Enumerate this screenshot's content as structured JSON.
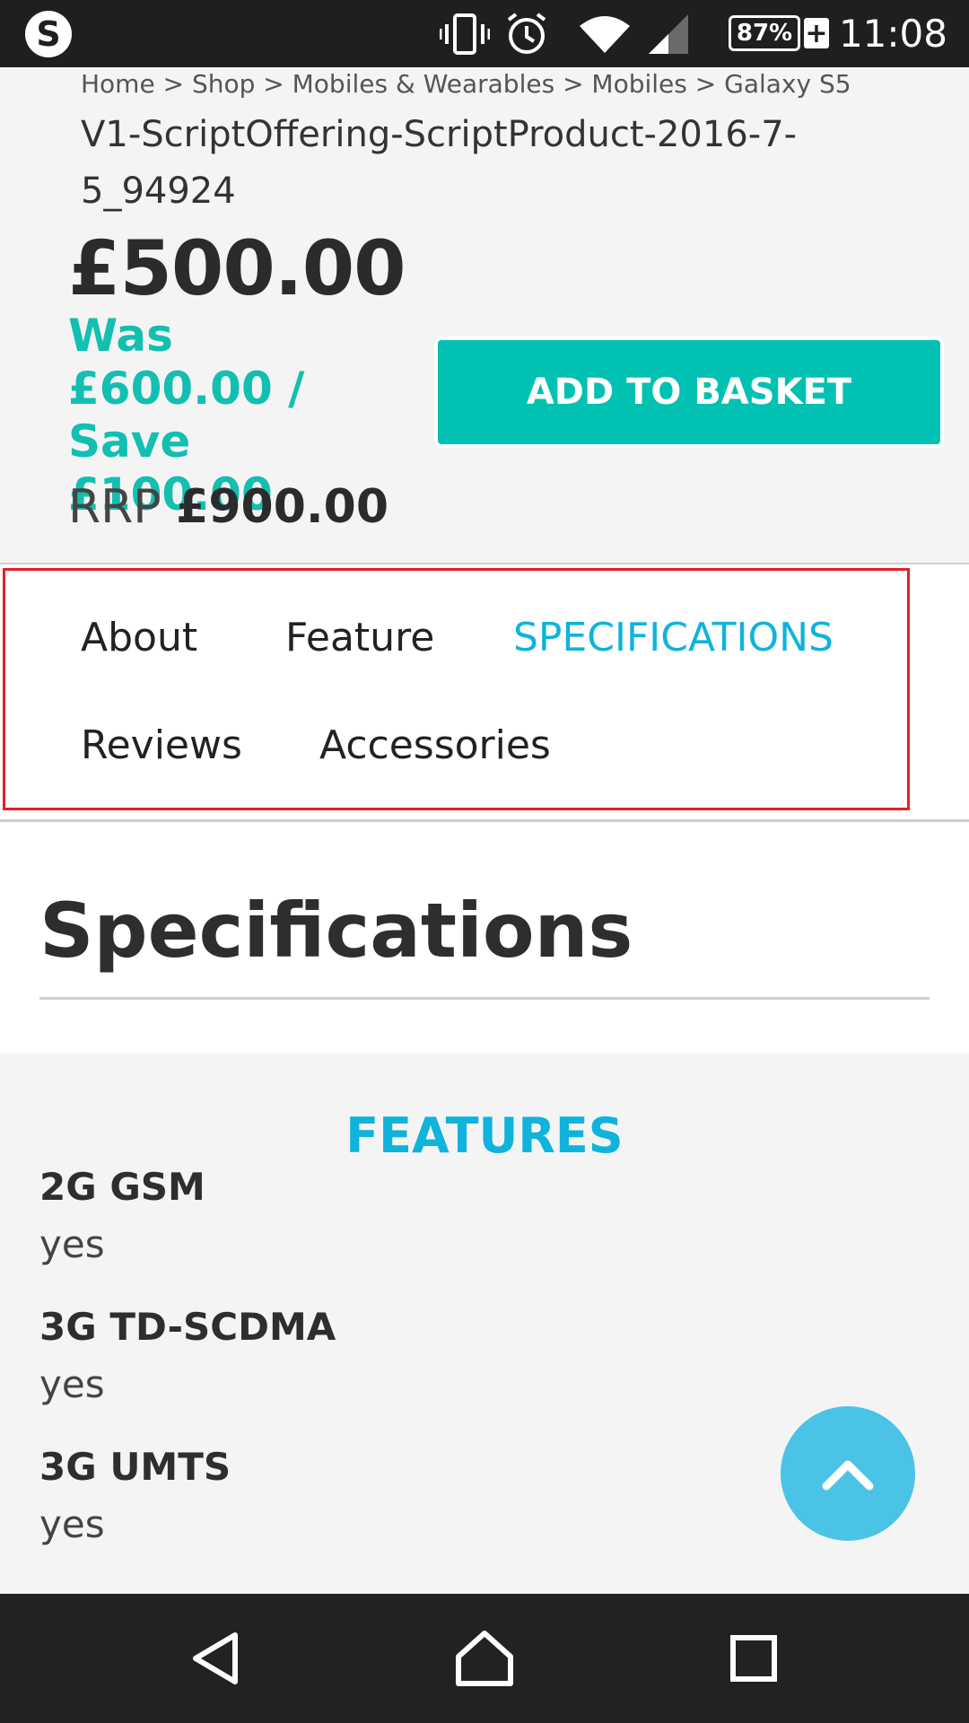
{
  "status_bar": {
    "time": "11:08",
    "battery": "87%",
    "battery_charging": "+",
    "icons": [
      "skype-icon",
      "vibrate-icon",
      "alarm-icon",
      "wifi-icon",
      "signal-icon",
      "battery-icon"
    ]
  },
  "breadcrumb": "Home > Shop >  Mobiles & Wearables >  Mobiles >  Galaxy S5",
  "product": {
    "title": "V1-ScriptOffering-ScriptProduct-2016-7-5_94924",
    "price": "£500.00",
    "was_text": "Was £600.00 / Save £100.00",
    "rrp_label": "RRP",
    "rrp_value": "£900.00",
    "add_button": "ADD TO BASKET"
  },
  "tabs": [
    {
      "label": "About",
      "active": false
    },
    {
      "label": "Feature",
      "active": false
    },
    {
      "label": "SPECIFICATIONS",
      "active": true
    },
    {
      "label": "Reviews",
      "active": false
    },
    {
      "label": "Accessories",
      "active": false
    }
  ],
  "spec": {
    "title": "Specifications",
    "section_heading": "FEATURES",
    "items": [
      {
        "name": "2G GSM",
        "value": "yes"
      },
      {
        "name": "3G TD-SCDMA",
        "value": "yes"
      },
      {
        "name": "3G UMTS",
        "value": "yes"
      }
    ]
  },
  "colors": {
    "accent_teal": "#00c1b2",
    "accent_blue": "#0fb3dc",
    "scroll_button": "#4bc3e7",
    "highlight_border": "#e3212d"
  },
  "nav": [
    "back-icon",
    "home-icon",
    "recents-icon"
  ]
}
